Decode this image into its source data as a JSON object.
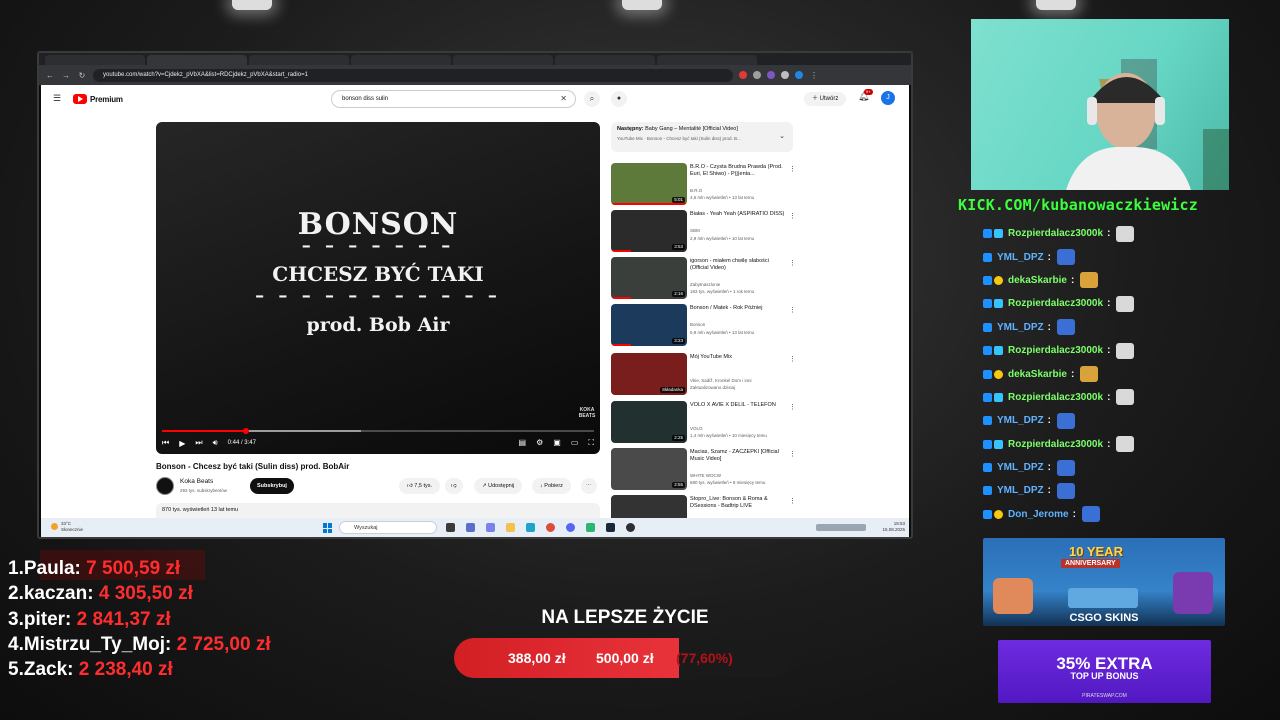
{
  "browser": {
    "url": "youtube.com/watch?v=Cjdekz_pVbXA&list=RDCjdekz_pVbXA&start_radio=1"
  },
  "youtube": {
    "logo_text": "Premium",
    "search_value": "bonson diss sulin",
    "create_label": "Utwórz",
    "notif_count": "9+",
    "avatar_letter": "J",
    "video": {
      "overlay_artist": "BONSON",
      "overlay_dashes_1": "– – – – – – –",
      "overlay_title": "CHCESZ BYĆ TAKI",
      "overlay_dashes_2": "– – – – – – – – – – –",
      "overlay_prod": "prod. Bob Air",
      "watermark": "KOKA BEATS",
      "time": "0:44 / 3:47",
      "progress_fraction": 0.194,
      "buffer_fraction": 0.46,
      "title": "Bonson - Chcesz być taki (Sulin diss) prod. BobAir",
      "channel": "Koka Beats",
      "subscribers": "293 tys. subskrybentów",
      "subscribe_label": "Subskrybuj",
      "likes": "7,5 tys.",
      "share_label": "Udostępnij",
      "download_label": "Pobierz",
      "description": "870 tys. wyświetleń  13 lat temu"
    },
    "up_next": {
      "label": "Następny:",
      "title": "Baby Gang – Mentalité [Official Video]",
      "sub": "YouTube Mix · Bonson - Chcesz być taki (Sulin diss) prod. B..."
    },
    "recommendations": [
      {
        "title": "B.R.O - Czysta Brudna Prawda (Prod. Euri, El Shiwo) - P(j)enta...",
        "channel": "B.R.O",
        "meta": "4,6 mln wyświetleń • 13 lat temu",
        "duration": "5:01",
        "color": "#5d7a3a"
      },
      {
        "title": "Białas - Yeah Yeah (ASPIRATIO DISS)",
        "channel": "SBM",
        "meta": "2,9 mln wyświetleń • 10 lat temu",
        "duration": "3:53",
        "color": "#2b2b2b"
      },
      {
        "title": "igorson - miałem chwilę słabości (Official Video)",
        "channel": "Zabytnaszlonie",
        "meta": "183 tys. wyświetleń • 1 rok temu",
        "duration": "2:16",
        "color": "#3a3f3c"
      },
      {
        "title": "Bonson / Matek - Rok Później",
        "channel": "Bonson",
        "meta": "5,9 mln wyświetleń • 13 lat temu",
        "duration": "3:23",
        "color": "#1c3a5c"
      },
      {
        "title": "Mój YouTube Mix",
        "channel": "Vkie, Sadiž, Kronkel Dom i inni",
        "meta": "Zaktualizowano dzisiaj",
        "duration": "Składanka",
        "color": "#7a1d1d"
      },
      {
        "title": "VOLO X AVIE X DELIL - TELEFON",
        "channel": "VOLO",
        "meta": "1,4 mln wyświetleń • 10 miesięcy temu",
        "duration": "2:25",
        "color": "#223030"
      },
      {
        "title": "Macias, Szamz - ZACZEPKI [Official Music Video]",
        "channel": "WHITE WOCW",
        "meta": "680 tys. wyświetleń • 8 miesięcy temu",
        "duration": "2:55",
        "color": "#4a4a4a"
      },
      {
        "title": "Stopro_Live: Bonson & Roma & DSessions - Badtrip LIVE",
        "channel": "",
        "meta": "",
        "duration": "",
        "color": "#333333"
      }
    ]
  },
  "taskbar": {
    "weather_temp": "33°C",
    "weather_desc": "Słonecznie",
    "search_placeholder": "Wyszukaj",
    "time": "18:53",
    "date": "15.08.2025"
  },
  "stream": {
    "kick_link": "KICK.COM/kubanowaczkiewicz",
    "chat": [
      {
        "user": "Rozpierdalacz3000k",
        "color": "#7dff6b",
        "badges": [
          "b-blue",
          "b-cyan"
        ],
        "emote": "#d9d9d9"
      },
      {
        "user": "YML_DPZ",
        "color": "#5fb3ff",
        "badges": [
          "b-blue"
        ],
        "emote": "#3a6fd6"
      },
      {
        "user": "dekaSkarbie",
        "color": "#7dff6b",
        "badges": [
          "b-blue",
          "b-gold"
        ],
        "emote": "#d9a23a"
      },
      {
        "user": "Rozpierdalacz3000k",
        "color": "#7dff6b",
        "badges": [
          "b-blue",
          "b-cyan"
        ],
        "emote": "#d9d9d9"
      },
      {
        "user": "YML_DPZ",
        "color": "#5fb3ff",
        "badges": [
          "b-blue"
        ],
        "emote": "#3a6fd6"
      },
      {
        "user": "Rozpierdalacz3000k",
        "color": "#7dff6b",
        "badges": [
          "b-blue",
          "b-cyan"
        ],
        "emote": "#d9d9d9"
      },
      {
        "user": "dekaSkarbie",
        "color": "#7dff6b",
        "badges": [
          "b-blue",
          "b-gold"
        ],
        "emote": "#d9a23a"
      },
      {
        "user": "Rozpierdalacz3000k",
        "color": "#7dff6b",
        "badges": [
          "b-blue",
          "b-cyan"
        ],
        "emote": "#d9d9d9"
      },
      {
        "user": "YML_DPZ",
        "color": "#5fb3ff",
        "badges": [
          "b-blue"
        ],
        "emote": "#3a6fd6"
      },
      {
        "user": "Rozpierdalacz3000k",
        "color": "#7dff6b",
        "badges": [
          "b-blue",
          "b-cyan"
        ],
        "emote": "#d9d9d9"
      },
      {
        "user": "YML_DPZ",
        "color": "#5fb3ff",
        "badges": [
          "b-blue"
        ],
        "emote": "#3a6fd6"
      },
      {
        "user": "YML_DPZ",
        "color": "#5fb3ff",
        "badges": [
          "b-blue"
        ],
        "emote": "#3a6fd6"
      },
      {
        "user": "Don_Jerome",
        "color": "#5fb3ff",
        "badges": [
          "b-blue",
          "b-gold"
        ],
        "emote": "#3a6fd6"
      }
    ],
    "donors": [
      {
        "rank": "1.",
        "name": "Paula:",
        "amount": "7 500,59 zł"
      },
      {
        "rank": "2.",
        "name": "kaczan:",
        "amount": "4 305,50 zł"
      },
      {
        "rank": "3.",
        "name": "piter:",
        "amount": "2 841,37 zł"
      },
      {
        "rank": "4.",
        "name": "Mistrzu_Ty_Moj:",
        "amount": "2 725,00 zł"
      },
      {
        "rank": "5.",
        "name": "Zack:",
        "amount": "2 238,40 zł"
      }
    ],
    "goal": {
      "title": "NA LEPSZE ŻYCIE",
      "current": "388,00 zł",
      "target": "500,00 zł",
      "percent": "(77,60%)",
      "fraction": 0.776
    },
    "csgo_banner": {
      "year": "10 YEAR",
      "anniversary": "ANNIVERSARY",
      "brand": "CSGO SKINS"
    },
    "pirate_banner": {
      "extra": "35% EXTRA",
      "bonus": "TOP UP BONUS",
      "site": "PIRATESWAP.COM"
    }
  }
}
